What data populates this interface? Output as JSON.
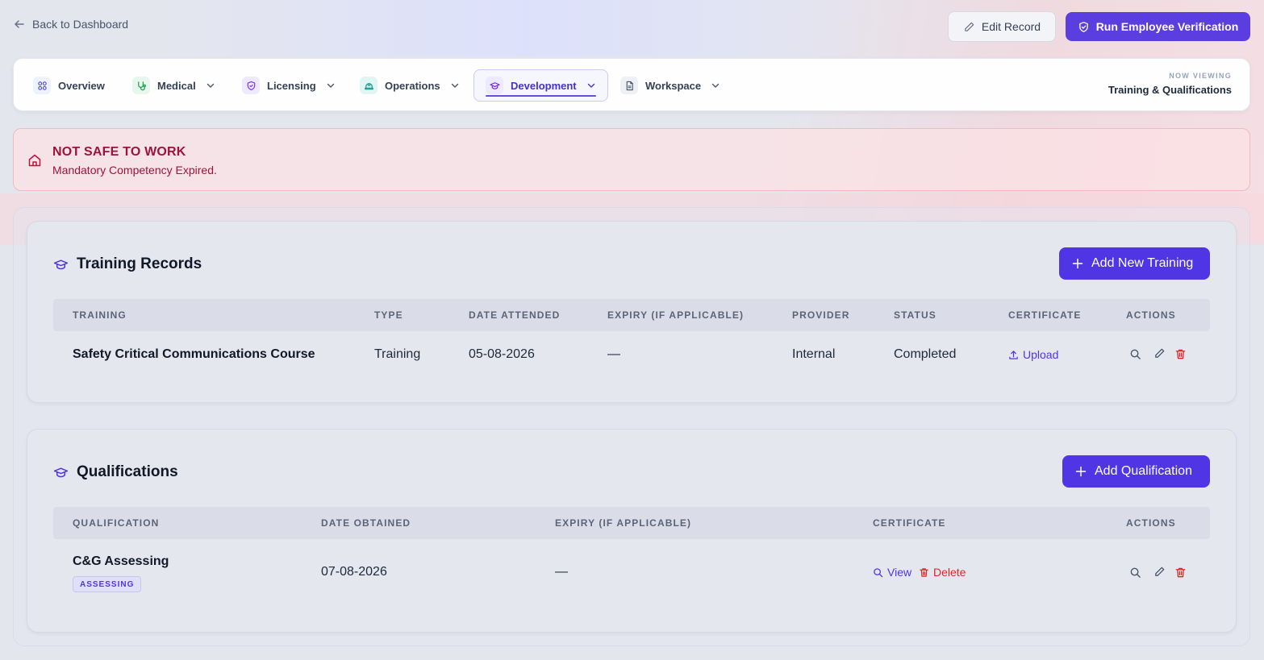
{
  "header": {
    "back_label": "Back to Dashboard",
    "edit_label": "Edit Record",
    "verify_label": "Run Employee Verification"
  },
  "nav": {
    "tabs": [
      {
        "label": "Overview",
        "icon": "grid-icon",
        "has_dropdown": false
      },
      {
        "label": "Medical",
        "icon": "stethoscope-icon",
        "has_dropdown": true
      },
      {
        "label": "Licensing",
        "icon": "shield-icon",
        "has_dropdown": true
      },
      {
        "label": "Operations",
        "icon": "hard-hat-icon",
        "has_dropdown": true
      },
      {
        "label": "Development",
        "icon": "graduation-cap-icon",
        "has_dropdown": true,
        "active": true
      },
      {
        "label": "Workspace",
        "icon": "document-icon",
        "has_dropdown": true
      }
    ],
    "now_viewing_label": "NOW VIEWING",
    "now_viewing_value": "Training & Qualifications"
  },
  "alert": {
    "title": "NOT SAFE TO WORK",
    "message": "Mandatory Competency Expired."
  },
  "training": {
    "title": "Training Records",
    "add_label": "Add New Training",
    "columns": [
      "TRAINING",
      "TYPE",
      "DATE ATTENDED",
      "EXPIRY (IF APPLICABLE)",
      "PROVIDER",
      "STATUS",
      "CERTIFICATE",
      "ACTIONS"
    ],
    "rows": [
      {
        "training": "Safety Critical Communications Course",
        "type": "Training",
        "date_attended": "05-08-2026",
        "expiry": "—",
        "provider": "Internal",
        "status": "Completed",
        "certificate_action": "Upload"
      }
    ]
  },
  "qualifications": {
    "title": "Qualifications",
    "add_label": "Add Qualification",
    "columns": [
      "QUALIFICATION",
      "DATE OBTAINED",
      "EXPIRY (IF APPLICABLE)",
      "CERTIFICATE",
      "ACTIONS"
    ],
    "rows": [
      {
        "qualification": "C&G Assessing",
        "tag": "ASSESSING",
        "date_obtained": "07-08-2026",
        "expiry": "—",
        "view_label": "View",
        "delete_label": "Delete"
      }
    ]
  },
  "colors": {
    "accent": "#4f35e3",
    "danger": "#dc2626",
    "alert_text": "#9f1239"
  }
}
